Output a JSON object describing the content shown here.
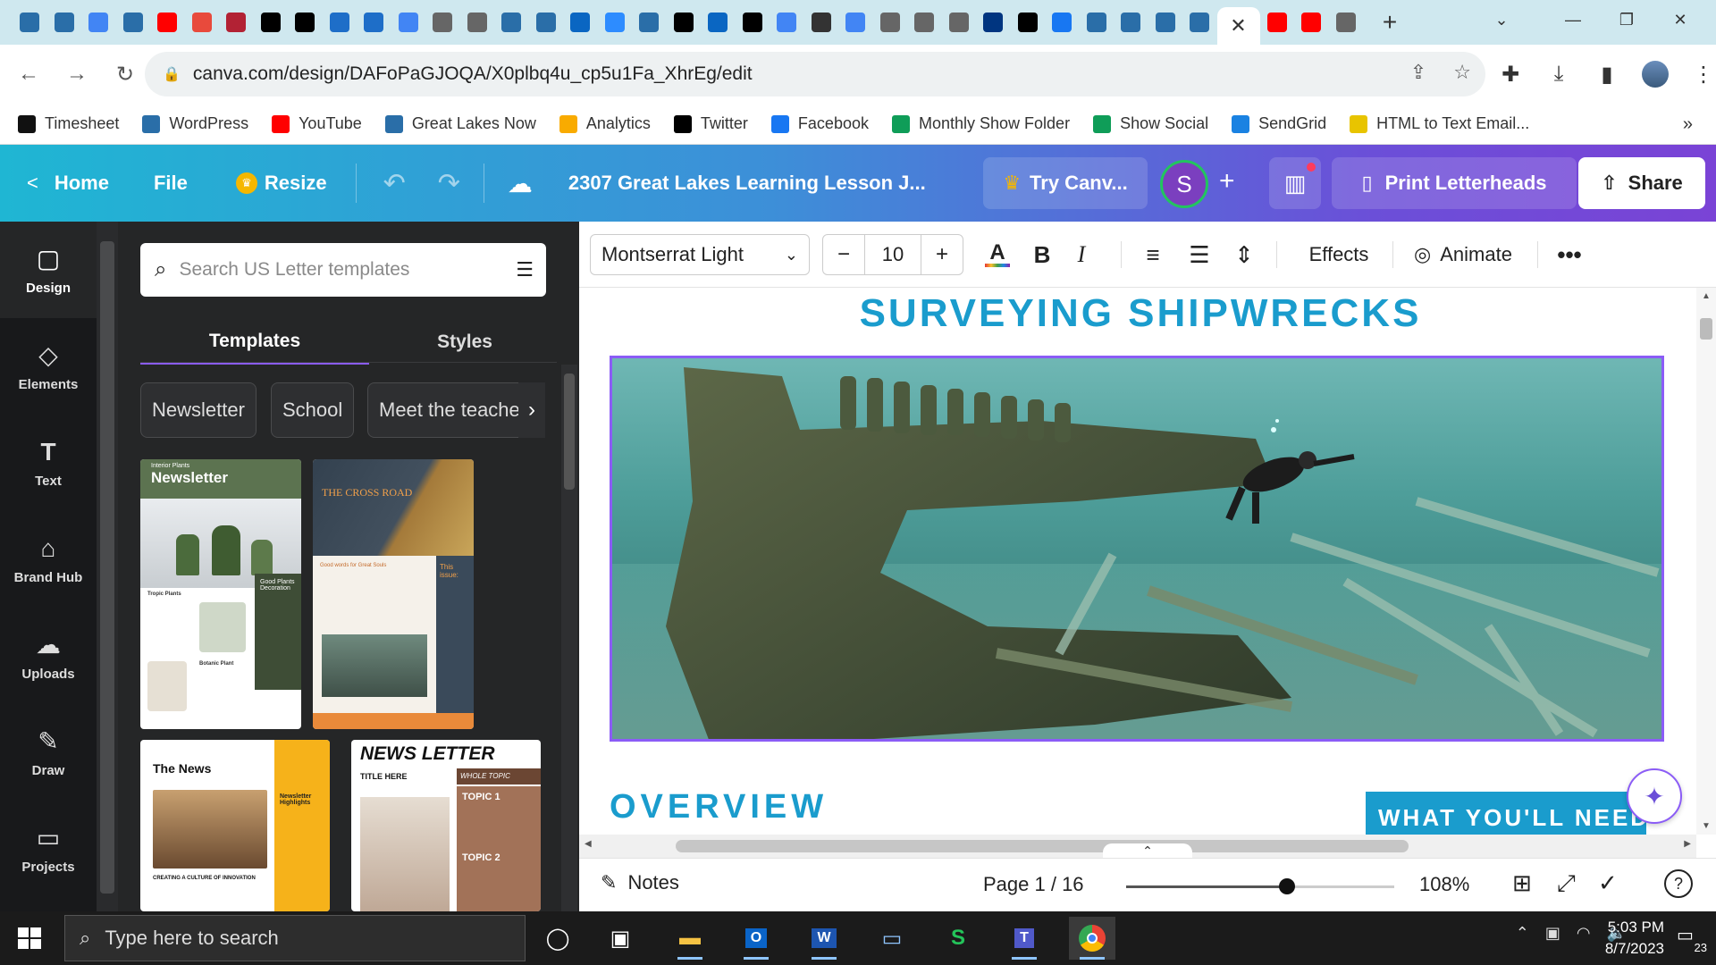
{
  "browser": {
    "tabs": [
      {
        "icon": "great-lakes-now-favicon",
        "color": "#2a6ea8"
      },
      {
        "icon": "great-lakes-now-favicon",
        "color": "#2a6ea8"
      },
      {
        "icon": "google-docs-favicon",
        "color": "#4285f4"
      },
      {
        "icon": "great-lakes-now-favicon",
        "color": "#2a6ea8"
      },
      {
        "icon": "youtube-favicon",
        "color": "#ff0000"
      },
      {
        "icon": "pbs-favicon",
        "color": "#e84a3c"
      },
      {
        "icon": "us-flag-favicon",
        "color": "#b22234"
      },
      {
        "icon": "x-favicon",
        "color": "#000000"
      },
      {
        "icon": "x-favicon",
        "color": "#000000"
      },
      {
        "icon": "shield-favicon",
        "color": "#1e6ec8"
      },
      {
        "icon": "shield-favicon",
        "color": "#1e6ec8"
      },
      {
        "icon": "google-favicon",
        "color": "#4285f4"
      },
      {
        "icon": "chromium-favicon",
        "color": "#666666"
      },
      {
        "icon": "globe-favicon",
        "color": "#666666"
      },
      {
        "icon": "great-lakes-now-favicon",
        "color": "#2a6ea8"
      },
      {
        "icon": "great-lakes-now-favicon",
        "color": "#2a6ea8"
      },
      {
        "icon": "linkedin-favicon",
        "color": "#0a66c2"
      },
      {
        "icon": "zoom-favicon",
        "color": "#2d8cff"
      },
      {
        "icon": "great-lakes-now-favicon",
        "color": "#2a6ea8"
      },
      {
        "icon": "ap-favicon",
        "color": "#000000"
      },
      {
        "icon": "linkedin-favicon",
        "color": "#0a66c2"
      },
      {
        "icon": "x-favicon",
        "color": "#000000"
      },
      {
        "icon": "google-docs-favicon",
        "color": "#4285f4"
      },
      {
        "icon": "hn-favicon",
        "color": "#333333"
      },
      {
        "icon": "google-favicon",
        "color": "#4285f4"
      },
      {
        "icon": "chromium-favicon",
        "color": "#666666"
      },
      {
        "icon": "chromium-favicon",
        "color": "#666666"
      },
      {
        "icon": "chromium-favicon",
        "color": "#666666"
      },
      {
        "icon": "booking-favicon",
        "color": "#003580"
      },
      {
        "icon": "x-favicon",
        "color": "#000000"
      },
      {
        "icon": "facebook-favicon",
        "color": "#1877f2"
      },
      {
        "icon": "great-lakes-now-favicon",
        "color": "#2a6ea8"
      },
      {
        "icon": "great-lakes-now-favicon",
        "color": "#2a6ea8"
      },
      {
        "icon": "great-lakes-now-favicon",
        "color": "#2a6ea8"
      },
      {
        "icon": "great-lakes-now-favicon",
        "color": "#2a6ea8"
      }
    ],
    "active_tab_close": "✕",
    "tabs_after": [
      {
        "icon": "youtube-favicon",
        "color": "#ff0000"
      },
      {
        "icon": "youtube-favicon",
        "color": "#ff0000"
      },
      {
        "icon": "globe-favicon",
        "color": "#666666"
      }
    ],
    "new_tab": "+",
    "url": "canva.com/design/DAFoPaGJOQA/X0plbq4u_cp5u1Fa_XhrEg/edit"
  },
  "bookmarks": [
    {
      "label": "Timesheet",
      "icon": "github-icon",
      "color": "#111111"
    },
    {
      "label": "WordPress",
      "icon": "great-lakes-now-icon",
      "color": "#2a6ea8"
    },
    {
      "label": "YouTube",
      "icon": "youtube-icon",
      "color": "#ff0000"
    },
    {
      "label": "Great Lakes Now",
      "icon": "great-lakes-now-icon",
      "color": "#2a6ea8"
    },
    {
      "label": "Analytics",
      "icon": "analytics-icon",
      "color": "#f9ab00"
    },
    {
      "label": "Twitter",
      "icon": "x-icon",
      "color": "#000000"
    },
    {
      "label": "Facebook",
      "icon": "facebook-icon",
      "color": "#1877f2"
    },
    {
      "label": "Monthly Show Folder",
      "icon": "google-drive-icon",
      "color": "#0f9d58"
    },
    {
      "label": "Show Social",
      "icon": "google-sheets-icon",
      "color": "#0f9d58"
    },
    {
      "label": "SendGrid",
      "icon": "sendgrid-icon",
      "color": "#1a82e2"
    },
    {
      "label": "HTML to Text Email...",
      "icon": "html-to-text-icon",
      "color": "#e8c400"
    }
  ],
  "canva": {
    "home": "Home",
    "file": "File",
    "resize": "Resize",
    "doc_title": "2307 Great Lakes Learning Lesson J...",
    "try": "Try Canv...",
    "avatar_letter": "S",
    "print": "Print Letterheads",
    "share": "Share"
  },
  "rail": [
    {
      "label": "Design",
      "icon": "design-icon",
      "glyph": "▢"
    },
    {
      "label": "Elements",
      "icon": "elements-icon",
      "glyph": "◇"
    },
    {
      "label": "Text",
      "icon": "text-icon",
      "glyph": "T"
    },
    {
      "label": "Brand Hub",
      "icon": "brand-hub-icon",
      "glyph": "⌂"
    },
    {
      "label": "Uploads",
      "icon": "uploads-icon",
      "glyph": "☁"
    },
    {
      "label": "Draw",
      "icon": "draw-icon",
      "glyph": "✎"
    },
    {
      "label": "Projects",
      "icon": "projects-icon",
      "glyph": "▭"
    }
  ],
  "panel": {
    "search_placeholder": "Search US Letter templates",
    "tab_templates": "Templates",
    "tab_styles": "Styles",
    "chips": [
      "Newsletter",
      "School",
      "Meet the teache"
    ],
    "t1": {
      "small": "Interior Plants",
      "title": "Newsletter",
      "sub1": "Tropic Plants",
      "sub2": "Good Plants Decoration",
      "sub3": "Botanic Plant"
    },
    "t2": {
      "title": "THE CROSS ROAD",
      "sub": "Good words for Great Souls",
      "issue": "This issue:"
    },
    "t3": {
      "title": "The News",
      "sub": "Creating a culture of innovation",
      "side": "Newsletter Highlights"
    },
    "t4": {
      "title": "NEWS LETTER",
      "title2": "TITLE HERE",
      "whole": "WHOLE TOPIC",
      "topic1": "TOPIC 1",
      "topic2": "TOPIC 2"
    }
  },
  "toolbar": {
    "font": "Montserrat Light",
    "size": "10",
    "effects": "Effects",
    "animate": "Animate"
  },
  "canvas": {
    "title": "SURVEYING SHIPWRECKS",
    "overview": "OVERVIEW",
    "need": "WHAT YOU'LL NEED"
  },
  "footer": {
    "notes": "Notes",
    "page": "Page 1 / 16",
    "zoom": "108%",
    "zoom_slider_fraction": 0.6
  },
  "taskbar": {
    "search_placeholder": "Type here to search",
    "time": "5:03 PM",
    "date": "8/7/2023",
    "notifications": "23"
  }
}
